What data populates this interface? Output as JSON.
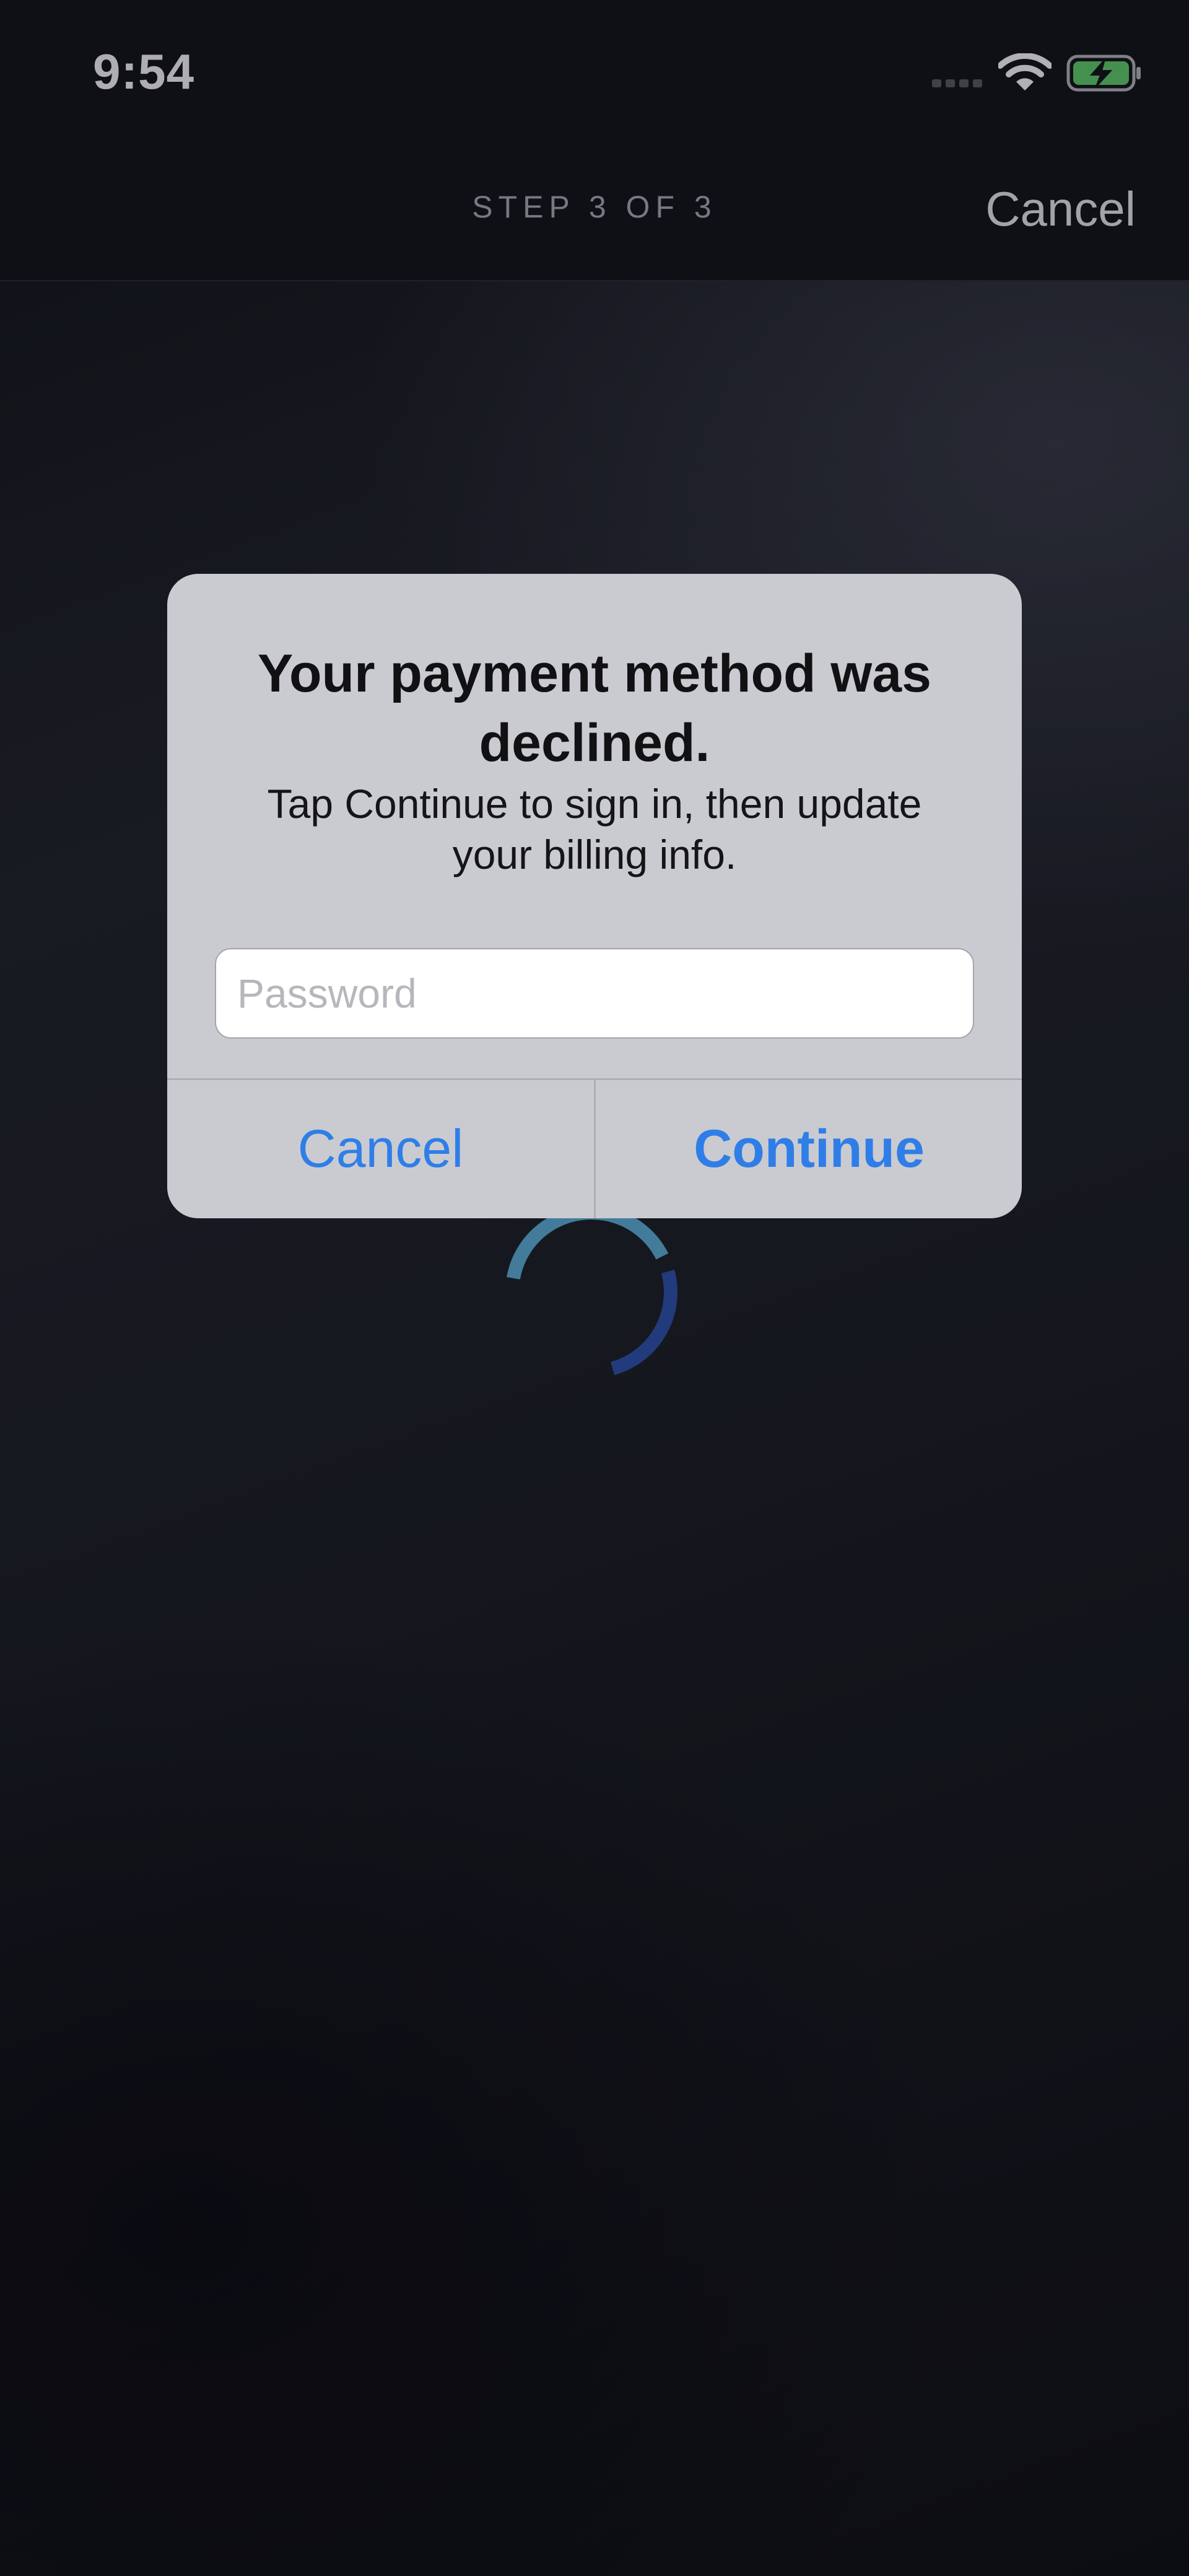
{
  "status_bar": {
    "time": "9:54",
    "signal_icon": "cellular-signal-icon",
    "wifi_icon": "wifi-icon",
    "battery_icon": "battery-charging-icon",
    "battery_color": "#5ec16a"
  },
  "nav": {
    "step_label": "STEP 3 OF 3",
    "cancel_label": "Cancel"
  },
  "loading": {
    "icon": "loading-spinner-icon",
    "colors": [
      "#5aa6cf",
      "#2e4fa6"
    ]
  },
  "alert": {
    "title": "Your payment method was declined.",
    "message": "Tap Continue to sign in, then update your billing info.",
    "password_placeholder": "Password",
    "password_value": "",
    "cancel_label": "Cancel",
    "continue_label": "Continue",
    "button_color": "#2f7ee8"
  }
}
